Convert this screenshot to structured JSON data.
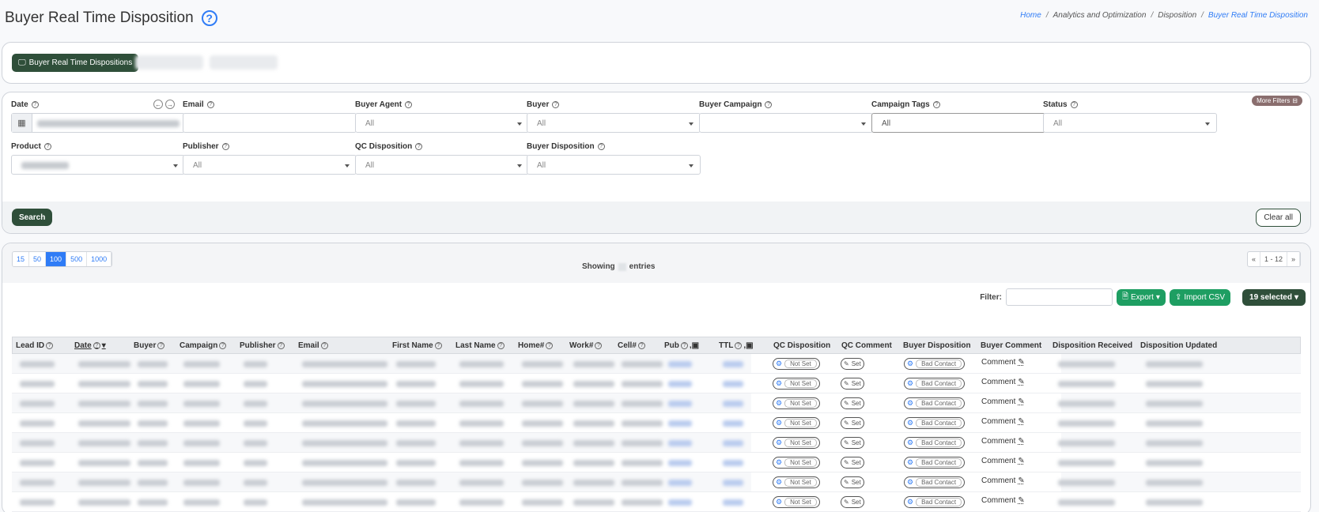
{
  "header": {
    "title": "Buyer Real Time Disposition",
    "breadcrumb": [
      "Home",
      "Analytics and Optimization",
      "Disposition",
      "Buyer Real Time Disposition"
    ]
  },
  "tabs": {
    "active": "Buyer Real Time Dispositions"
  },
  "filters": {
    "more_filters": "More Filters",
    "date": "Date",
    "email": "Email",
    "buyer_agent": "Buyer Agent",
    "buyer": "Buyer",
    "buyer_campaign": "Buyer Campaign",
    "campaign_tags": "Campaign Tags",
    "status": "Status",
    "product": "Product",
    "publisher": "Publisher",
    "qc_disposition": "QC Disposition",
    "buyer_disposition": "Buyer Disposition",
    "all": "All",
    "search": "Search",
    "clear_all": "Clear all"
  },
  "table_controls": {
    "page_sizes": [
      "15",
      "50",
      "100",
      "500",
      "1000"
    ],
    "active_page_size": "100",
    "showing": "Showing",
    "entries": "entries",
    "pager": [
      "«",
      "1 - 12",
      "»"
    ],
    "filter_label": "Filter:",
    "export": "Export",
    "import_csv": "Import CSV",
    "selected": "19 selected"
  },
  "columns": [
    "Lead ID",
    "Date",
    "Buyer",
    "Campaign",
    "Publisher",
    "Email",
    "First Name",
    "Last Name",
    "Home#",
    "Work#",
    "Cell#",
    "Pub",
    "TTL",
    "QC Disposition",
    "QC Comment",
    "Buyer Disposition",
    "Buyer Comment",
    "Disposition Received",
    "Disposition Updated"
  ],
  "row_values": {
    "qc_disposition": "Not Set",
    "qc_comment": "Set",
    "buyer_disposition": "Bad Contact",
    "buyer_comment": "Comment"
  },
  "row_count": 8
}
